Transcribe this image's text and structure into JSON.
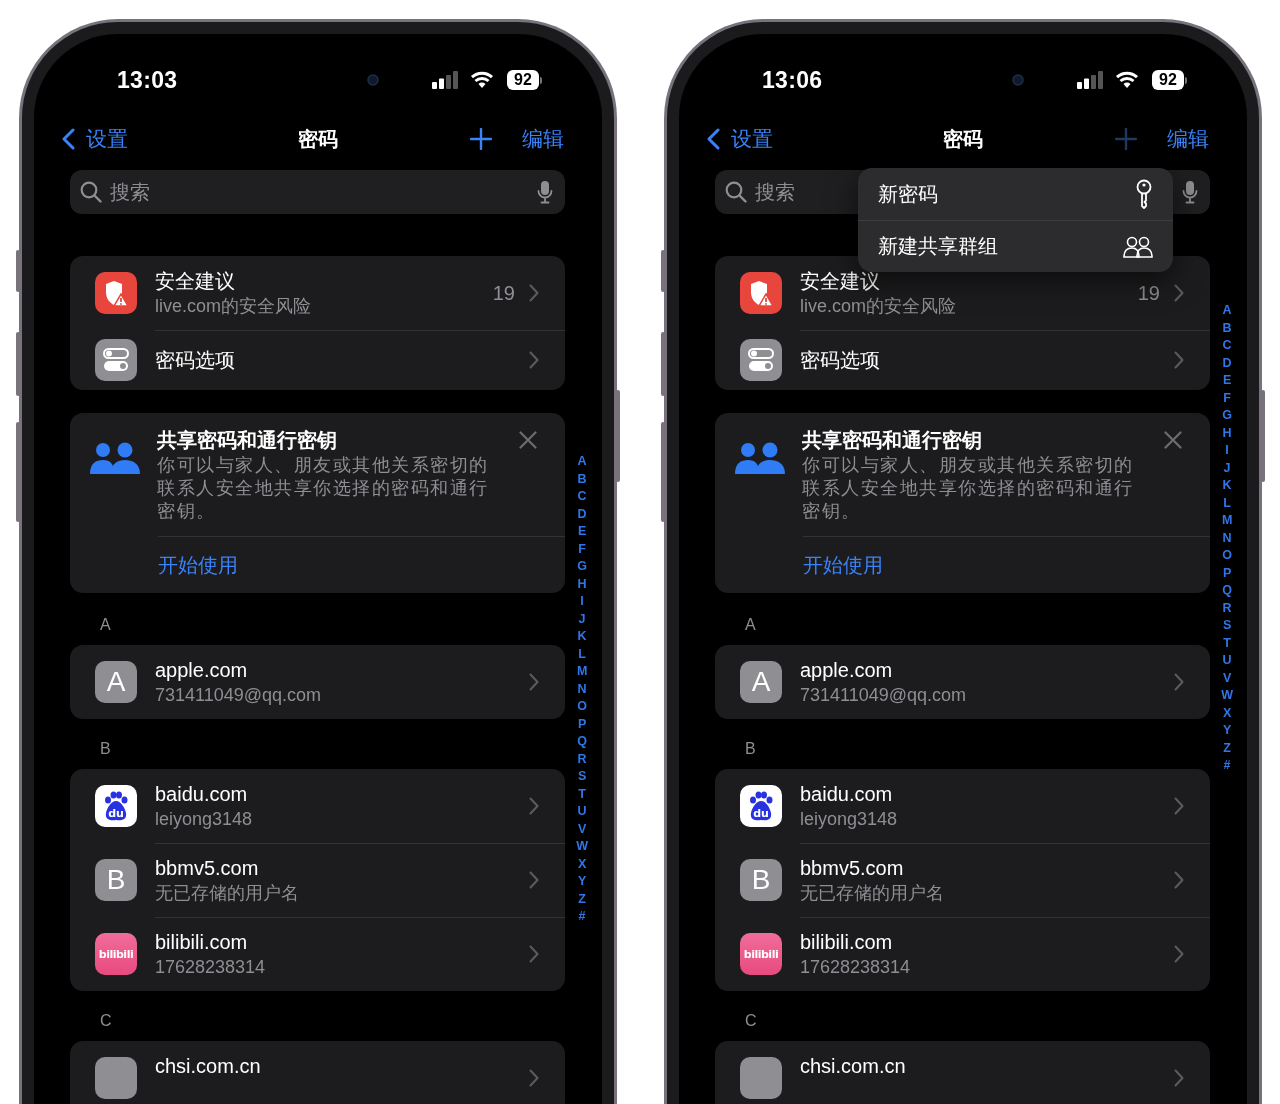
{
  "phones": [
    {
      "status": {
        "time": "13:03",
        "battery": "92"
      },
      "nav": {
        "back": "设置",
        "title": "密码",
        "add_dimmed": false,
        "edit": "编辑"
      },
      "search": {
        "placeholder": "搜索"
      },
      "top_rows": [
        {
          "kind": "security",
          "title": "安全建议",
          "subtitle": "live.com的安全风险",
          "count": "19"
        },
        {
          "kind": "options",
          "title": "密码选项"
        }
      ],
      "share_card": {
        "title": "共享密码和通行密钥",
        "description": "你可以与家人、朋友或其他关系密切的联系人安全地共享你选择的密码和通行密钥。",
        "action": "开始使用"
      },
      "sections": [
        {
          "header": "A",
          "rows": [
            {
              "kind": "letter",
              "letter": "A",
              "title": "apple.com",
              "subtitle": "731411049@qq.com"
            }
          ]
        },
        {
          "header": "B",
          "rows": [
            {
              "kind": "baidu",
              "logo_text": "du",
              "title": "baidu.com",
              "subtitle": "leiyong3148"
            },
            {
              "kind": "letter",
              "letter": "B",
              "title": "bbmv5.com",
              "subtitle": "无已存储的用户名"
            },
            {
              "kind": "bilibili",
              "logo_text": "bilibili",
              "title": "bilibili.com",
              "subtitle": "17628238314"
            }
          ]
        },
        {
          "header": "C",
          "rows": [
            {
              "kind": "letter",
              "title": "chsi.com.cn"
            }
          ]
        }
      ],
      "index": [
        "A",
        "B",
        "C",
        "D",
        "E",
        "F",
        "G",
        "H",
        "I",
        "J",
        "K",
        "L",
        "M",
        "N",
        "O",
        "P",
        "Q",
        "R",
        "S",
        "T",
        "U",
        "V",
        "W",
        "X",
        "Y",
        "Z",
        "#"
      ]
    },
    {
      "status": {
        "time": "13:06",
        "battery": "92"
      },
      "nav": {
        "back": "设置",
        "title": "密码",
        "add_dimmed": true,
        "edit": "编辑"
      },
      "search": {
        "placeholder": "搜索"
      },
      "menu": [
        {
          "kind": "key",
          "label": "新密码"
        },
        {
          "kind": "group",
          "label": "新建共享群组"
        }
      ],
      "top_rows": [
        {
          "kind": "security",
          "title": "安全建议",
          "subtitle": "live.com的安全风险",
          "count": "19"
        },
        {
          "kind": "options",
          "title": "密码选项"
        }
      ],
      "share_card": {
        "title": "共享密码和通行密钥",
        "description": "你可以与家人、朋友或其他关系密切的联系人安全地共享你选择的密码和通行密钥。",
        "action": "开始使用"
      },
      "sections": [
        {
          "header": "A",
          "rows": [
            {
              "kind": "letter",
              "letter": "A",
              "title": "apple.com",
              "subtitle": "731411049@qq.com"
            }
          ]
        },
        {
          "header": "B",
          "rows": [
            {
              "kind": "baidu",
              "logo_text": "du",
              "title": "baidu.com",
              "subtitle": "leiyong3148"
            },
            {
              "kind": "letter",
              "letter": "B",
              "title": "bbmv5.com",
              "subtitle": "无已存储的用户名"
            },
            {
              "kind": "bilibili",
              "logo_text": "bilibili",
              "title": "bilibili.com",
              "subtitle": "17628238314"
            }
          ]
        },
        {
          "header": "C",
          "rows": [
            {
              "kind": "letter",
              "title": "chsi.com.cn"
            }
          ]
        }
      ],
      "index": [
        "A",
        "B",
        "C",
        "D",
        "E",
        "F",
        "G",
        "H",
        "I",
        "J",
        "K",
        "L",
        "M",
        "N",
        "O",
        "P",
        "Q",
        "R",
        "S",
        "T",
        "U",
        "V",
        "W",
        "X",
        "Y",
        "Z",
        "#"
      ]
    }
  ]
}
